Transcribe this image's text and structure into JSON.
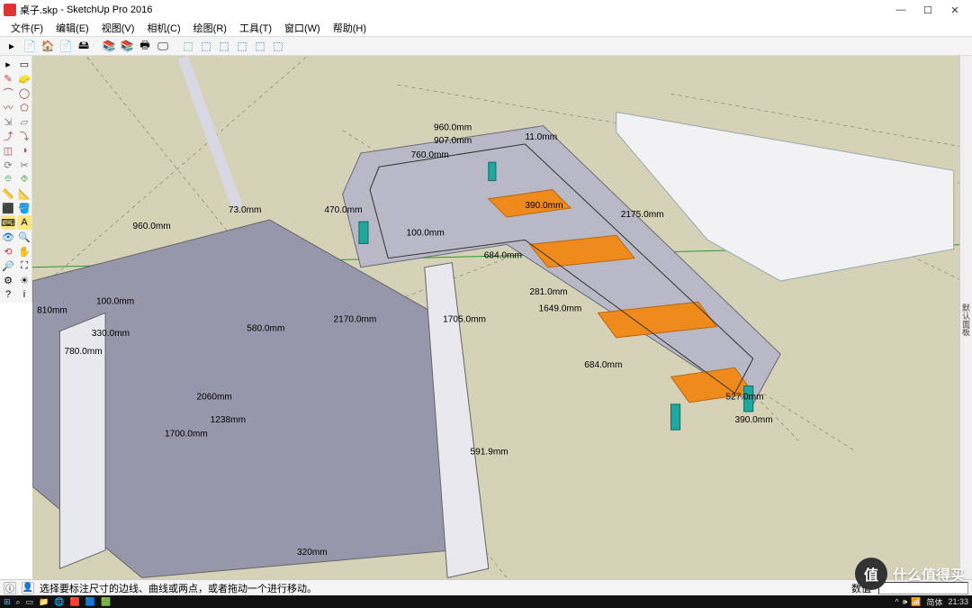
{
  "title": {
    "filename": "桌子.skp",
    "app": "SketchUp Pro 2016"
  },
  "window_buttons": {
    "min": "—",
    "max": "☐",
    "close": "✕"
  },
  "menu": [
    "文件(F)",
    "编辑(E)",
    "视图(V)",
    "相机(C)",
    "绘图(R)",
    "工具(T)",
    "窗口(W)",
    "帮助(H)"
  ],
  "top_toolbar_icons": [
    "▸",
    "📄",
    "🏠",
    "📄",
    "🖴",
    "",
    "📚",
    "📚",
    "🖶",
    "🖵",
    "",
    "⬚",
    "⬚",
    "⬚",
    "⬚",
    "⬚",
    "⬚"
  ],
  "left_tool_icons": [
    "▸",
    "▭",
    "✎",
    "🧽",
    "⌒",
    "◯",
    "〰",
    "⬠",
    "⇲",
    "▱",
    "⤴",
    "⤵",
    "◫",
    "◑",
    "⟳",
    "✂",
    "⯐",
    "⯑",
    "📏",
    "📐",
    "⬛",
    "🪣",
    "⌨",
    "A",
    "👁",
    "🔍",
    "⟲",
    "✋",
    "🔎",
    "⛶",
    "⚙",
    "☀",
    "?",
    "i"
  ],
  "right_panel_label": "默认面板",
  "dimensions": {
    "d1": "960.0mm",
    "d2": "907.0mm",
    "d3": "470.0mm",
    "d4": "390.0mm",
    "d5": "2175.0mm",
    "d6": "684.0mm",
    "d7": "1705.0mm",
    "d8": "281.0mm",
    "d9": "1649.0mm",
    "d10": "684.0mm",
    "d11": "527.0mm",
    "d12": "390.0mm",
    "d13": "960.0mm",
    "d14": "73.0mm",
    "d15": "100.0mm",
    "d16": "580.0mm",
    "d17": "2170.0mm",
    "d18": "780.0mm",
    "d19": "330.0mm",
    "d20": "810mm",
    "d21": "2060mm",
    "d22": "1238mm",
    "d23": "1700.0mm",
    "d24": "320mm",
    "d25": "591.9mm",
    "d26": "100.0mm",
    "d27": "760.0mm",
    "d28": "11.0mm"
  },
  "status": {
    "hint": "选择要标注尺寸的边线、曲线或两点，或者拖动一个进行移动。",
    "vcb_label": "数值"
  },
  "taskbar": {
    "time": "21:33",
    "ime": "简体",
    "tray": [
      "^",
      "🕪",
      "📶"
    ]
  },
  "watermark": "什么值得买"
}
